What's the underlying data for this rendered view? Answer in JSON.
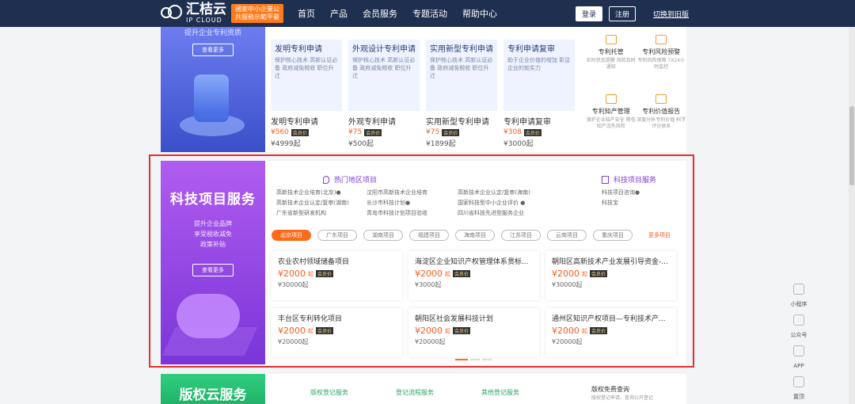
{
  "header": {
    "logo_cn": "汇桔云",
    "logo_en": "IP CLOUD",
    "promo": "國家中小企業公共服務示範平臺",
    "nav": [
      "首页",
      "产品",
      "会员服务",
      "专题活动",
      "帮助中心"
    ],
    "login": "登录",
    "register": "注册",
    "switch": "切换到旧版"
  },
  "upper": {
    "banner_sub": "提升企业专利资质",
    "banner_more": "查看更多",
    "cards": [
      {
        "title": "发明专利申请",
        "desc": "保护核心技术 高新认证必备 政府减免税收 职位升迁",
        "name": "发明专利申请",
        "price": "¥560",
        "vip": "会员价",
        "orig": "¥4999起"
      },
      {
        "title": "外观设计专利申请",
        "desc": "保护核心技术 高新认证必备 政府减免税收 职位升迁",
        "name": "外观专利申请",
        "price": "¥75",
        "vip": "会员价",
        "orig": "¥500起"
      },
      {
        "title": "实用新型专利申请",
        "desc": "保护核心技术 高新认证必备 政府减免税收 职位升迁",
        "name": "实用新型专利申请",
        "price": "¥75",
        "vip": "会员价",
        "orig": "¥1899起"
      },
      {
        "title": "专利申请复审",
        "desc": "助于企业价值的增加 彰显企业的软实力",
        "name": "专利申请复审",
        "price": "¥308",
        "vip": "会员价",
        "orig": "¥3000起"
      }
    ],
    "services": [
      {
        "name": "专利托管",
        "desc": "实时状态提醒 风险及时通知"
      },
      {
        "name": "专利风险预警",
        "desc": "专利风险保障 7X24小时监控"
      },
      {
        "name": "专利知产管理",
        "desc": "保护企业知产安全 降低知产流失风险"
      },
      {
        "name": "专利价值报告",
        "desc": "深度分析专利价值 科学评分体系"
      }
    ]
  },
  "tech": {
    "title": "科技项目服务",
    "sub1": "提升企业品牌",
    "sub2": "享受税收减免",
    "sub3": "政策补贴",
    "more": "查看更多",
    "hot_title": "热门地区项目",
    "svc_title": "科技项目服务",
    "hot_links": [
      "高新技术企业培育(北京)",
      "沈阳市高新技术企业培育",
      "高新技术企业认定/复审(海南)",
      "高新技术企业认定/复审(湖南)",
      "长沙市科技计划",
      "国家科技型中小企业评价",
      "广东省新型研发机构",
      "青岛市科技计划项目验收",
      "四川省科技先进型服务企业"
    ],
    "svc_links": [
      "科技项目咨询",
      "科技宝"
    ],
    "tabs": [
      "北京项目",
      "广东项目",
      "湖南项目",
      "福建项目",
      "海南项目",
      "江苏项目",
      "云南项目",
      "重庆项目"
    ],
    "more_link": "更多项目",
    "projects": [
      {
        "name": "农业农村领域储备项目",
        "price": "¥2000",
        "unit": "起",
        "vip": "会员价",
        "orig": "¥30000起"
      },
      {
        "name": "海淀区企业知识产权管理体系贯标...",
        "price": "¥2000",
        "unit": "起",
        "vip": "会员价",
        "orig": "¥3000起"
      },
      {
        "name": "朝阳区高新技术产业发展引导资金-...",
        "price": "¥2000",
        "unit": "起",
        "vip": "会员价",
        "orig": "¥30000起"
      },
      {
        "name": "丰台区专利转化项目",
        "price": "¥2000",
        "unit": "起",
        "vip": "会员价",
        "orig": "¥20000起"
      },
      {
        "name": "朝阳区社会发展科技计划",
        "price": "¥2000",
        "unit": "起",
        "vip": "会员价",
        "orig": "¥20000起"
      },
      {
        "name": "通州区知识产权项目—专利技术产...",
        "price": "¥2000",
        "unit": "起",
        "vip": "会员价",
        "orig": "¥20000起"
      }
    ]
  },
  "bottom": {
    "title": "版权云服务",
    "links": [
      "版权登记服务",
      "登记流程服务",
      "其他登记服务"
    ],
    "right_title": "版权免费查询",
    "right_desc": "版权登记申请，查询公开登记"
  },
  "float": [
    "小程序",
    "公众号",
    "APP",
    "置顶"
  ]
}
